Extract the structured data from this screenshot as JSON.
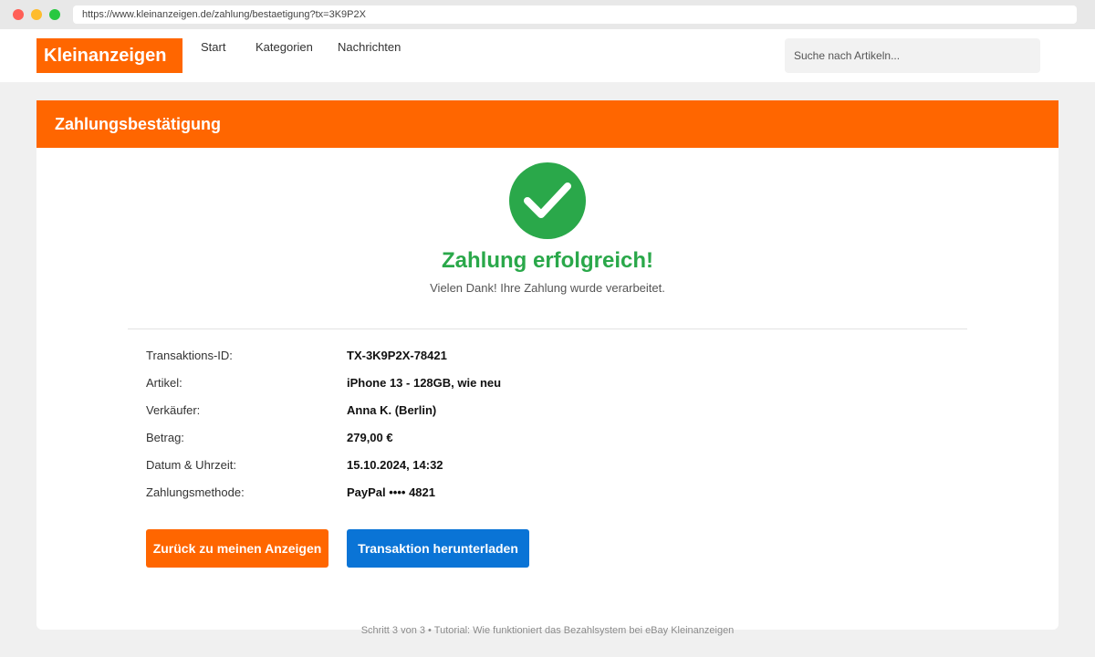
{
  "browser": {
    "url": "https://www.kleinanzeigen.de/zahlung/bestaetigung?tx=3K9P2X"
  },
  "header": {
    "logo": "Kleinanzeigen",
    "nav": [
      "Start",
      "Kategorien",
      "Nachrichten"
    ],
    "search_placeholder": "Suche nach Artikeln..."
  },
  "card": {
    "title": "Zahlungsbestätigung",
    "success_title": "Zahlung erfolgreich!",
    "success_subtitle": "Vielen Dank! Ihre Zahlung wurde verarbeitet.",
    "details": [
      {
        "label": "Transaktions-ID:",
        "value": "TX-3K9P2X-78421"
      },
      {
        "label": "Artikel:",
        "value": "iPhone 13 - 128GB, wie neu"
      },
      {
        "label": "Verkäufer:",
        "value": "Anna K. (Berlin)"
      },
      {
        "label": "Betrag:",
        "value": "279,00 €"
      },
      {
        "label": "Datum & Uhrzeit:",
        "value": "15.10.2024, 14:32"
      },
      {
        "label": "Zahlungsmethode:",
        "value": "PayPal •••• 4821"
      }
    ],
    "buttons": {
      "back": "Zurück zu meinen Anzeigen",
      "download": "Transaktion herunterladen"
    }
  },
  "footer": "Schritt 3 von 3 • Tutorial: Wie funktioniert das Bezahlsystem bei eBay Kleinanzeigen",
  "colors": {
    "brand": "#ff6600",
    "success": "#2aa84a",
    "primary_button": "#0a74d6"
  },
  "icons": {
    "success": "checkmark-circle-icon"
  }
}
